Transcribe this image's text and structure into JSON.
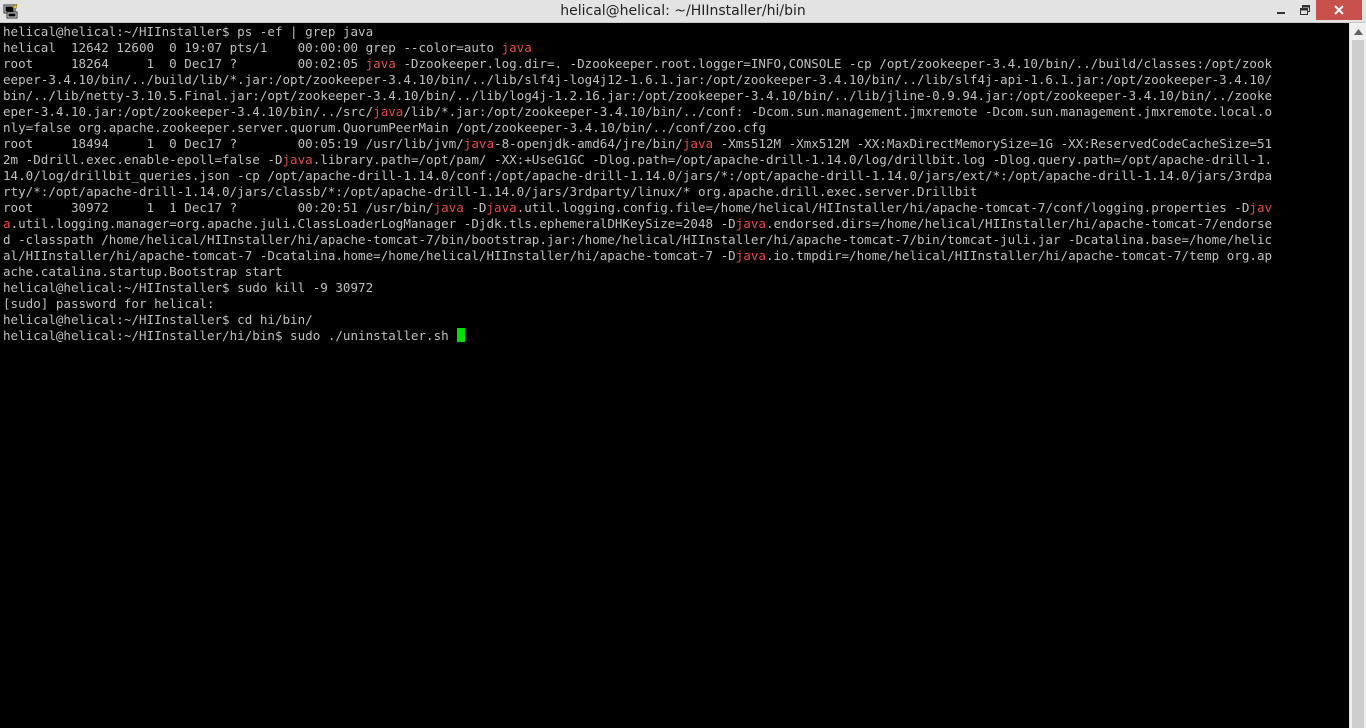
{
  "window": {
    "title": "helical@helical: ~/HIInstaller/hi/bin"
  },
  "icons": {
    "app": "putty-icon",
    "minimize": "minimize-icon",
    "maximize": "restore-icon",
    "close": "close-icon",
    "scroll_up": "arrow-up-icon"
  },
  "colors": {
    "background": "#000000",
    "text": "#c0c0c0",
    "highlight": "#e84848",
    "cursor": "#00e000",
    "close_button": "#c7504a"
  },
  "terminal": {
    "lines": [
      "helical@helical:~/HIInstaller$ ps -ef | grep java",
      "helical  12642 12600  0 19:07 pts/1    00:00:00 grep --color=auto [[java]]",
      "root     18264     1  0 Dec17 ?        00:02:05 [[java]] -Dzookeeper.log.dir=. -Dzookeeper.root.logger=INFO,CONSOLE -cp /opt/zookeeper-3.4.10/bin/../build/classes:/opt/zook",
      "eeper-3.4.10/bin/../build/lib/*.jar:/opt/zookeeper-3.4.10/bin/../lib/slf4j-log4j12-1.6.1.jar:/opt/zookeeper-3.4.10/bin/../lib/slf4j-api-1.6.1.jar:/opt/zookeeper-3.4.10/",
      "bin/../lib/netty-3.10.5.Final.jar:/opt/zookeeper-3.4.10/bin/../lib/log4j-1.2.16.jar:/opt/zookeeper-3.4.10/bin/../lib/jline-0.9.94.jar:/opt/zookeeper-3.4.10/bin/../zooke",
      "eper-3.4.10.jar:/opt/zookeeper-3.4.10/bin/../src/[[java]]/lib/*.jar:/opt/zookeeper-3.4.10/bin/../conf: -Dcom.sun.management.jmxremote -Dcom.sun.management.jmxremote.local.o",
      "nly=false org.apache.zookeeper.server.quorum.QuorumPeerMain /opt/zookeeper-3.4.10/bin/../conf/zoo.cfg",
      "root     18494     1  0 Dec17 ?        00:05:19 /usr/lib/jvm/[[java]]-8-openjdk-amd64/jre/bin/[[java]] -Xms512M -Xmx512M -XX:MaxDirectMemorySize=1G -XX:ReservedCodeCacheSize=51",
      "2m -Ddrill.exec.enable-epoll=false -D[[java]].library.path=/opt/pam/ -XX:+UseG1GC -Dlog.path=/opt/apache-drill-1.14.0/log/drillbit.log -Dlog.query.path=/opt/apache-drill-1.",
      "14.0/log/drillbit_queries.json -cp /opt/apache-drill-1.14.0/conf:/opt/apache-drill-1.14.0/jars/*:/opt/apache-drill-1.14.0/jars/ext/*:/opt/apache-drill-1.14.0/jars/3rdpa",
      "rty/*:/opt/apache-drill-1.14.0/jars/classb/*:/opt/apache-drill-1.14.0/jars/3rdparty/linux/* org.apache.drill.exec.server.Drillbit",
      "root     30972     1  1 Dec17 ?        00:20:51 /usr/bin/[[java]] -D[[java]].util.logging.config.file=/home/helical/HIInstaller/hi/apache-tomcat-7/conf/logging.properties -D[[jav]]",
      "[[a]].util.logging.manager=org.apache.juli.ClassLoaderLogManager -Djdk.tls.ephemeralDHKeySize=2048 -D[[java]].endorsed.dirs=/home/helical/HIInstaller/hi/apache-tomcat-7/endorse",
      "d -classpath /home/helical/HIInstaller/hi/apache-tomcat-7/bin/bootstrap.jar:/home/helical/HIInstaller/hi/apache-tomcat-7/bin/tomcat-juli.jar -Dcatalina.base=/home/helic",
      "al/HIInstaller/hi/apache-tomcat-7 -Dcatalina.home=/home/helical/HIInstaller/hi/apache-tomcat-7 -D[[java]].io.tmpdir=/home/helical/HIInstaller/hi/apache-tomcat-7/temp org.ap",
      "ache.catalina.startup.Bootstrap start",
      "helical@helical:~/HIInstaller$ sudo kill -9 30972",
      "[sudo] password for helical:",
      "helical@helical:~/HIInstaller$ cd hi/bin/",
      "helical@helical:~/HIInstaller/hi/bin$ sudo ./uninstaller.sh "
    ]
  }
}
